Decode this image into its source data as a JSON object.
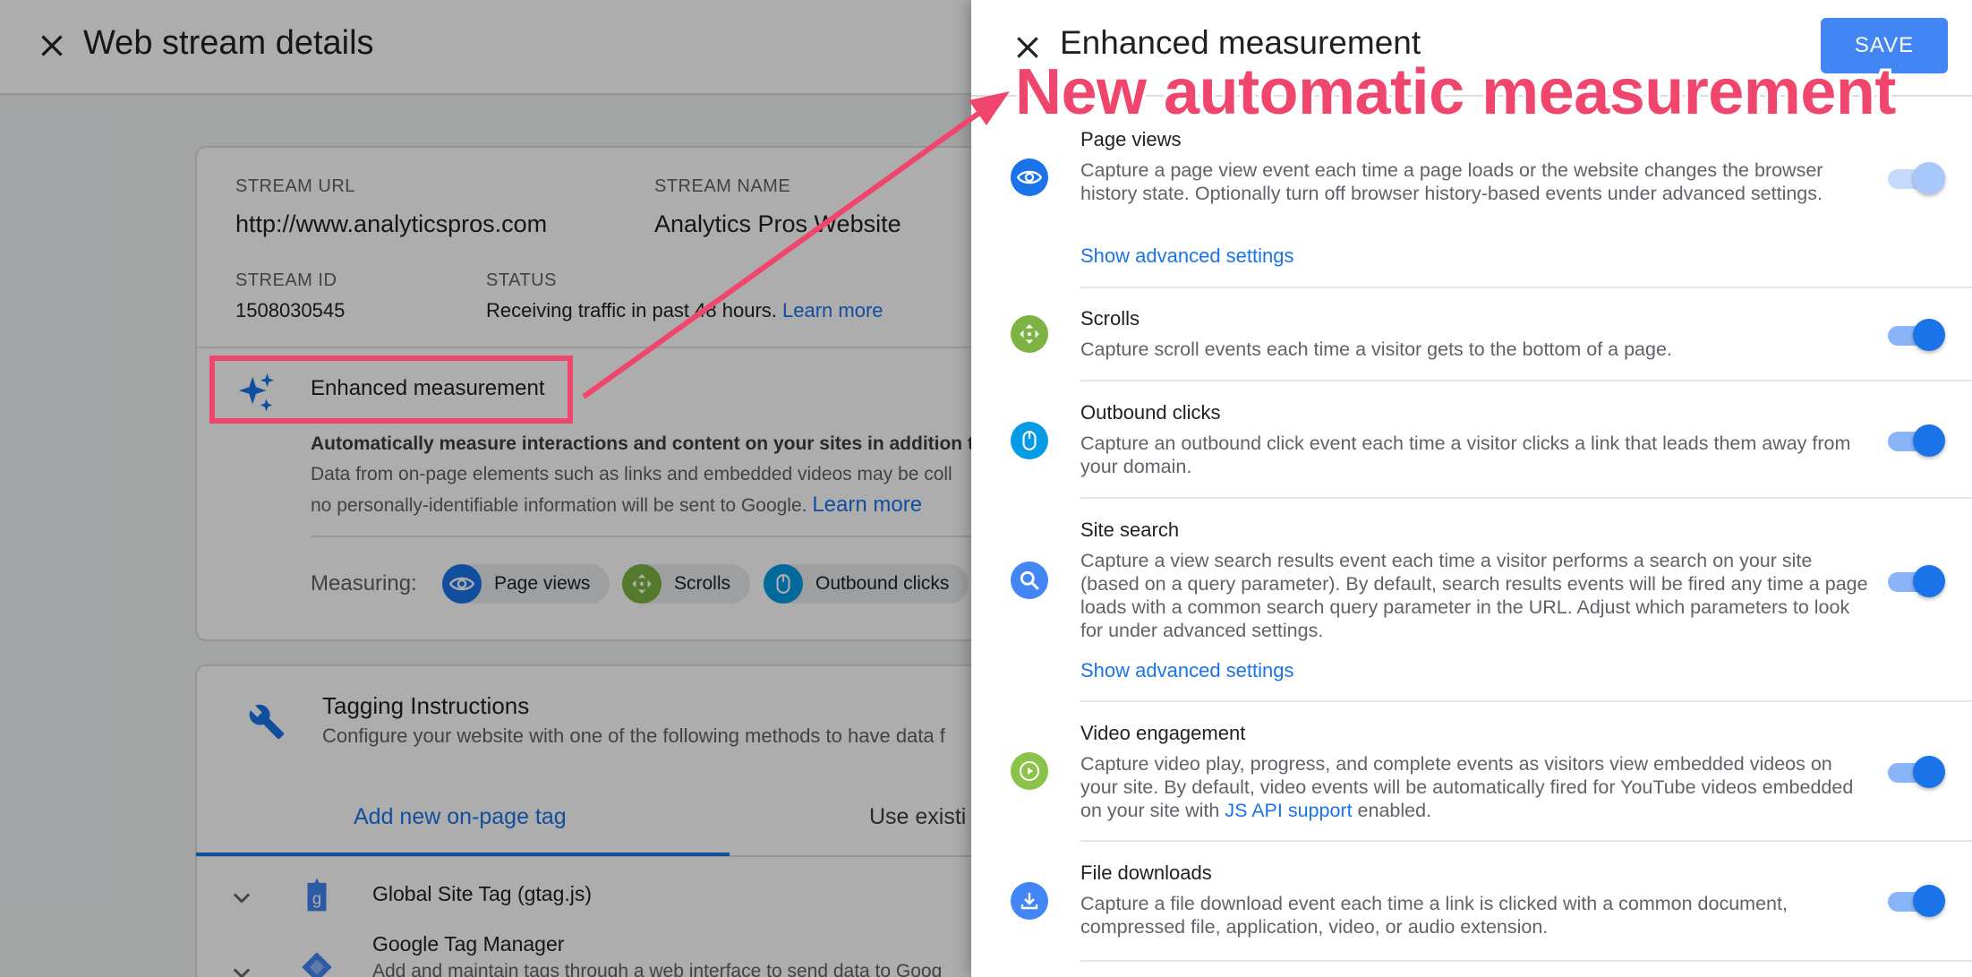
{
  "background": {
    "title": "Web stream details",
    "stream_url_label": "STREAM URL",
    "stream_url": "http://www.analyticspros.com",
    "stream_name_label": "STREAM NAME",
    "stream_name": "Analytics Pros Website",
    "stream_id_label": "STREAM ID",
    "stream_id": "1508030545",
    "status_label": "STATUS",
    "status_text": "Receiving traffic in past 48 hours.",
    "status_link": "Learn more",
    "em_title": "Enhanced measurement",
    "em_desc_line1": "Automatically measure interactions and content on your sites in addition to s",
    "em_desc_line2": "Data from on-page elements such as links and embedded videos may be coll",
    "em_desc_line3": "no personally-identifiable information will be sent to Google.",
    "em_desc_link": "Learn more",
    "measuring_label": "Measuring:",
    "chips": [
      "Page views",
      "Scrolls",
      "Outbound clicks"
    ],
    "tagging_title": "Tagging Instructions",
    "tagging_desc": "Configure your website with one of the following methods to have data f",
    "tab_active": "Add new on-page tag",
    "tab_inactive": "Use existi",
    "row1": "Global Site Tag (gtag.js)",
    "row2": "Google Tag Manager",
    "row2_sub": "Add and maintain tags through a web interface to send data to Goog"
  },
  "panel": {
    "title": "Enhanced measurement",
    "save_label": "SAVE",
    "items": [
      {
        "title": "Page views",
        "desc": "Capture a page view event each time a page loads or the website changes the browser history state. Optionally turn off browser history-based events under advanced settings.",
        "link": "Show advanced settings",
        "toggle": "on (disabled)",
        "icon": "eye-icon",
        "color": "#1a73e8"
      },
      {
        "title": "Scrolls",
        "desc": "Capture scroll events each time a visitor gets to the bottom of a page.",
        "toggle": "on",
        "icon": "scroll-arrows-icon",
        "color": "#7cb342"
      },
      {
        "title": "Outbound clicks",
        "desc": "Capture an outbound click event each time a visitor clicks a link that leads them away from your domain.",
        "toggle": "on",
        "icon": "mouse-icon",
        "color": "#039be5"
      },
      {
        "title": "Site search",
        "desc": "Capture a view search results event each time a visitor performs a search on your site (based on a query parameter). By default, search results events will be fired any time a page loads with a common search query parameter in the URL. Adjust which parameters to look for under advanced settings.",
        "link": "Show advanced settings",
        "toggle": "on",
        "icon": "search-icon",
        "color": "#4285f4"
      },
      {
        "title": "Video engagement",
        "desc_before": "Capture video play, progress, and complete events as visitors view embedded videos on your site. By default, video events will be automatically fired for YouTube videos embedded on your site with",
        "desc_link": "JS API support",
        "desc_after": "enabled.",
        "toggle": "on",
        "icon": "play-icon",
        "color": "#8bc34a"
      },
      {
        "title": "File downloads",
        "desc": "Capture a file download event each time a link is clicked with a common document, compressed file, application, video, or audio extension.",
        "toggle": "on",
        "icon": "download-icon",
        "color": "#4285f4"
      }
    ]
  },
  "annotation": {
    "text": "New automatic measurement",
    "color": "#f0466e"
  }
}
